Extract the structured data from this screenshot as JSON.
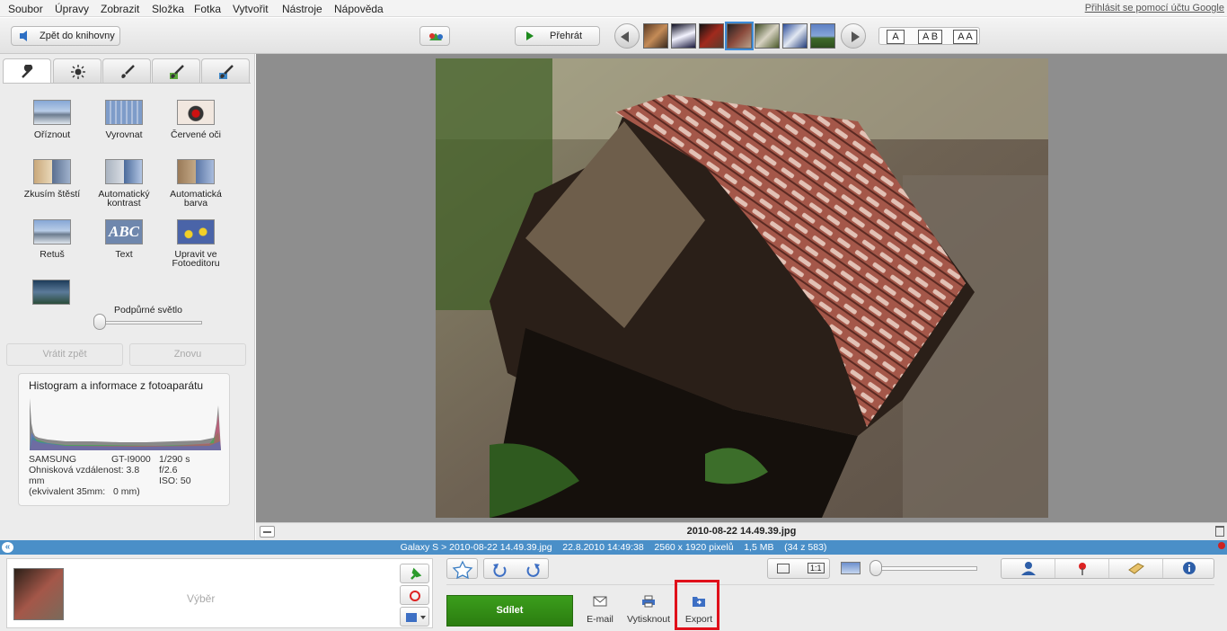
{
  "menu": {
    "items": [
      "Soubor",
      "Úpravy",
      "Zobrazit",
      "Složka",
      "Fotka",
      "Vytvořit",
      "Nástroje",
      "Nápověda"
    ],
    "signin": "Přihlásit se pomocí účtu Google"
  },
  "toolbar": {
    "back_label": "Zpět do knihovny",
    "play_label": "Přehrát",
    "text_modes": [
      "A",
      "A B",
      "A A"
    ]
  },
  "left_panel": {
    "tabs": [
      "wrench-icon",
      "sun-icon",
      "brush-icon",
      "brush-green-icon",
      "brush-blue-icon"
    ],
    "tools": [
      {
        "label": "Oříznout"
      },
      {
        "label": "Vyrovnat"
      },
      {
        "label": "Červené oči"
      },
      {
        "label": "Zkusím štěstí"
      },
      {
        "label": "Automatický kontrast"
      },
      {
        "label": "Automatická barva"
      },
      {
        "label": "Retuš"
      },
      {
        "label": "Text"
      },
      {
        "label": "Upravit ve Fotoeditoru"
      }
    ],
    "fill_light_label": "Podpůrné světlo",
    "fill_light_value": 0,
    "undo_label": "Vrátit zpět",
    "redo_label": "Znovu",
    "histogram": {
      "title": "Histogram a informace z fotoaparátu",
      "make": "SAMSUNG",
      "model": "GT-I9000",
      "focal": "Ohnisková vzdálenost: 3.8 mm",
      "equiv": "(ekvivalent 35mm:   0 mm)",
      "shutter": "1/290 s",
      "aperture": "f/2.6",
      "iso": "ISO: 50"
    }
  },
  "viewer": {
    "filename": "2010-08-22 14.49.39.jpg"
  },
  "infobar": {
    "text": "Galaxy S > 2010-08-22 14.49.39.jpg    22.8.2010 14:49:38    2560 x 1920 pixelů    1,5 MB    (34 z 583)"
  },
  "bottom": {
    "tray_label": "Výběr",
    "share_label": "Sdílet",
    "actions": [
      "E-mail",
      "Vytisknout",
      "Export"
    ],
    "zoom_buttons": [
      "",
      "1:1"
    ]
  },
  "colors": {
    "accent_blue": "#4a8fc8",
    "share_green": "#2b7d10",
    "highlight_red": "#e0101a"
  }
}
